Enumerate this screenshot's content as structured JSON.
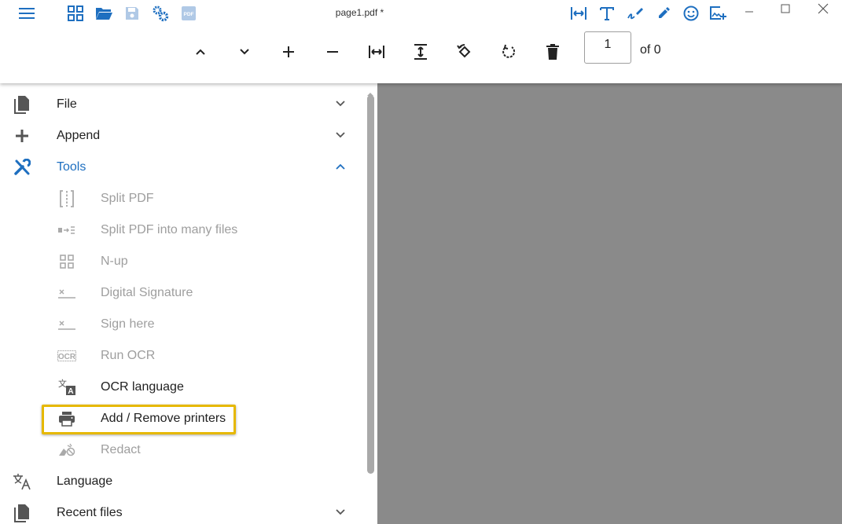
{
  "window": {
    "title": "page1.pdf *"
  },
  "toolbar": {
    "page_number": "1",
    "of_pages": "of 0"
  },
  "sidebar": {
    "file": "File",
    "append": "Append",
    "tools": "Tools",
    "tools_items": {
      "split_pdf": "Split PDF",
      "split_many": "Split PDF into many files",
      "nup": "N-up",
      "digital_signature": "Digital Signature",
      "sign_here": "Sign here",
      "run_ocr": "Run OCR",
      "ocr_language": "OCR language",
      "add_remove_printers": "Add / Remove printers",
      "redact": "Redact"
    },
    "language": "Language",
    "recent_files": "Recent files"
  },
  "colors": {
    "accent": "#1e6fc0",
    "disabled": "#9e9e9e",
    "viewer_background": "#8a8a8a",
    "highlight": "#e6b800"
  }
}
